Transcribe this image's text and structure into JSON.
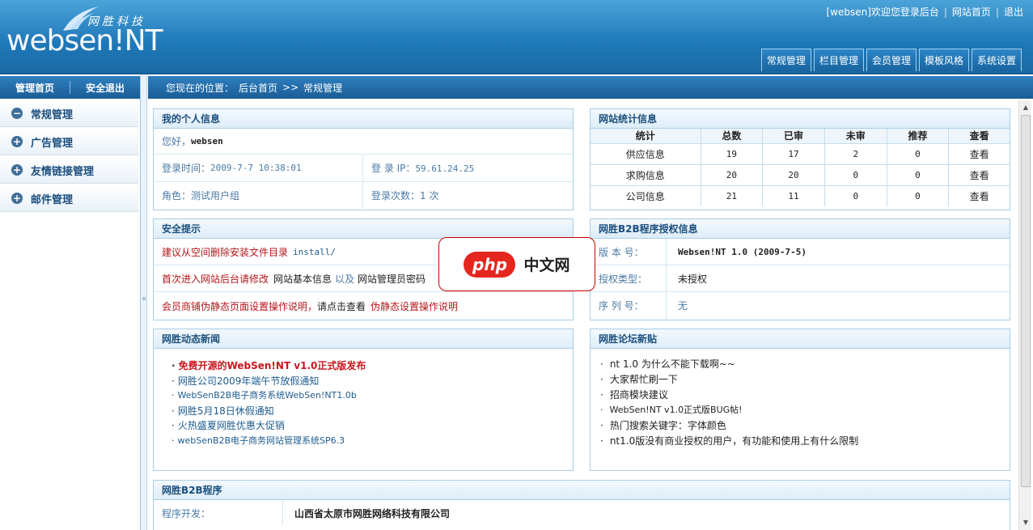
{
  "header": {
    "logo_text": "websen!NT",
    "logo_cn": "网胜科技",
    "toplinks": [
      "[websen]欢迎您登录后台",
      "网站首页",
      "退出"
    ],
    "nav": [
      "常规管理",
      "栏目管理",
      "会员管理",
      "模板风格",
      "系统设置"
    ]
  },
  "sidebar": {
    "head": [
      "管理首页",
      "安全退出"
    ],
    "items": [
      {
        "label": "常规管理",
        "icon": "−"
      },
      {
        "label": "广告管理",
        "icon": "+"
      },
      {
        "label": "友情链接管理",
        "icon": "+"
      },
      {
        "label": "邮件管理",
        "icon": "+"
      }
    ]
  },
  "breadcrumb": {
    "prefix": "您现在的位置：",
    "home": "后台首页",
    "sep": ">>",
    "current": "常规管理"
  },
  "profile": {
    "title": "我的个人信息",
    "greeting_label": "您好，",
    "greeting_name": "websen",
    "login_time_label": "登录时间：",
    "login_time": "2009-7-7 10:38:01",
    "login_ip_label": "登 录 IP：",
    "login_ip": "59.61.24.25",
    "role_label": "角色：",
    "role": "测试用户组",
    "login_count_label": "登录次数：",
    "login_count": "1 次"
  },
  "stats": {
    "title": "网站统计信息",
    "columns": [
      "统计",
      "总数",
      "已审",
      "未审",
      "推荐",
      "查看"
    ],
    "rows": [
      [
        "供应信息",
        "19",
        "17",
        "2",
        "0",
        "查看"
      ],
      [
        "求购信息",
        "20",
        "20",
        "0",
        "0",
        "查看"
      ],
      [
        "公司信息",
        "21",
        "11",
        "0",
        "0",
        "查看"
      ]
    ]
  },
  "security": {
    "title": "安全提示",
    "line1_red": "建议从空间删除安装文件目录",
    "line1_path": "install/",
    "line2_red": "首次进入网站后台请修改",
    "line2_a": "网站基本信息",
    "line2_mid": "以及",
    "line2_b": "网站管理员密码",
    "line3_red": "会员商铺伪静态页面设置操作说明，",
    "line3_mid": "请点击查看",
    "line3_link": "伪静态设置操作说明"
  },
  "license": {
    "title": "网胜B2B程序授权信息",
    "rows": [
      {
        "k": "版 本 号：",
        "v": "Websen!NT 1.0 (2009-7-5)"
      },
      {
        "k": "授权类型：",
        "v": "未授权"
      },
      {
        "k": "序 列 号：",
        "v": "无"
      }
    ]
  },
  "news": {
    "title": "网胜动态新闻",
    "items": [
      "免费开源的WebSen!NT v1.0正式版发布",
      "网胜公司2009年端午节放假通知",
      "WebSenB2B电子商务系统WebSen!NT1.0b",
      "网胜5月18日休假通知",
      "火热盛夏网胜优惠大促销",
      "webSenB2B电子商务网站管理系统SP6.3"
    ]
  },
  "forum": {
    "title": "网胜论坛新贴",
    "items": [
      "nt 1.0 为什么不能下载啊~~",
      "大家帮忙刷一下",
      "招商模块建议",
      "WebSen!NT v1.0正式版BUG帖!",
      "热门搜索关键字：字体颜色",
      "nt1.0版没有商业授权的用户，有功能和使用上有什么限制"
    ]
  },
  "program": {
    "title": "网胜B2B程序",
    "dev_label": "程序开发：",
    "dev_value": "山西省太原市网胜网络科技有限公司"
  },
  "watermark": {
    "pill": "php",
    "cn": "中文网"
  }
}
